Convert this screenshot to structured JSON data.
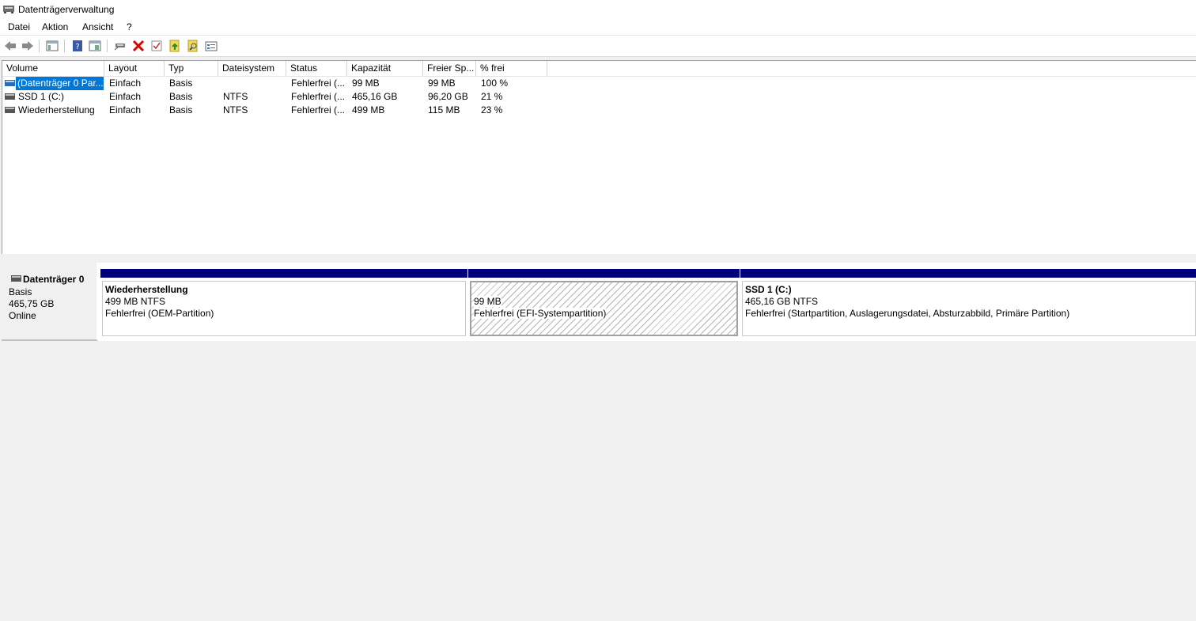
{
  "window": {
    "title": "Datenträgerverwaltung"
  },
  "menu": [
    "Datei",
    "Aktion",
    "Ansicht",
    "?"
  ],
  "toolbar": {
    "icons": [
      "back-icon",
      "forward-icon",
      "console-tree-icon",
      "help-icon",
      "console-view-icon",
      "connect-drive-icon",
      "delete-icon",
      "check-icon",
      "import-icon",
      "search-icon",
      "properties-icon"
    ]
  },
  "volume_list": {
    "columns": [
      "Volume",
      "Layout",
      "Typ",
      "Dateisystem",
      "Status",
      "Kapazität",
      "Freier Sp...",
      "% frei"
    ],
    "rows": [
      [
        "(Datenträger 0 Par...",
        "Einfach",
        "Basis",
        "",
        "Fehlerfrei (...",
        "99 MB",
        "99 MB",
        "100 %"
      ],
      [
        "SSD 1 (C:)",
        "Einfach",
        "Basis",
        "NTFS",
        "Fehlerfrei (...",
        "465,16 GB",
        "96,20 GB",
        "21 %"
      ],
      [
        "Wiederherstellung",
        "Einfach",
        "Basis",
        "NTFS",
        "Fehlerfrei (...",
        "499 MB",
        "115 MB",
        "23 %"
      ]
    ]
  },
  "disk": {
    "name": "Datenträger 0",
    "type": "Basis",
    "size": "465,75 GB",
    "state": "Online",
    "partitions": [
      {
        "title": "Wiederherstellung",
        "size": "499 MB NTFS",
        "status": "Fehlerfrei (OEM-Partition)"
      },
      {
        "title": "",
        "size": "99 MB",
        "status": "Fehlerfrei (EFI-Systempartition)"
      },
      {
        "title": "SSD 1  (C:)",
        "size": "465,16 GB NTFS",
        "status": "Fehlerfrei (Startpartition, Auslagerungsdatei, Absturzabbild, Primäre Partition)"
      }
    ]
  },
  "colors": {
    "partition_bar": "#00007f",
    "selection": "#0078d7"
  }
}
